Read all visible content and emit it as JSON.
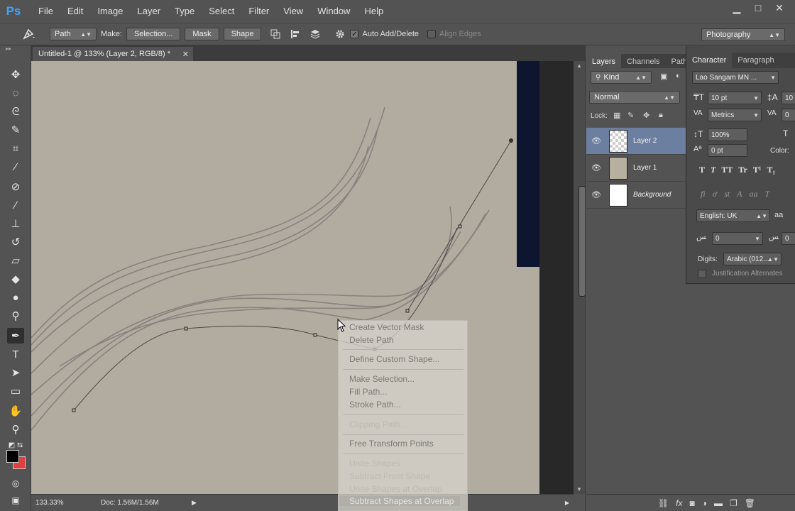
{
  "app": {
    "logo": "Ps"
  },
  "menu": [
    "File",
    "Edit",
    "Image",
    "Layer",
    "Type",
    "Select",
    "Filter",
    "View",
    "Window",
    "Help"
  ],
  "window_controls": {
    "minimize": "▁",
    "maximize": "□",
    "close": "✕"
  },
  "options_bar": {
    "mode": "Path",
    "make_label": "Make:",
    "selection_btn": "Selection...",
    "mask_btn": "Mask",
    "shape_btn": "Shape",
    "auto_add_delete": {
      "label": "Auto Add/Delete",
      "checked": true
    },
    "align_edges": {
      "label": "Align Edges",
      "checked": false
    },
    "workspace": "Photography"
  },
  "document": {
    "tab_title": "Untitled-1 @ 133% (Layer 2, RGB/8) *",
    "zoom": "133.33%",
    "doc_info": "Doc: 1.56M/1.56M"
  },
  "context_menu": {
    "items": [
      {
        "label": "Create Vector Mask",
        "enabled": true
      },
      {
        "label": "Delete Path",
        "enabled": true
      },
      {
        "label": "Define Custom Shape...",
        "enabled": true
      },
      {
        "label": "Make Selection...",
        "enabled": true
      },
      {
        "label": "Fill Path...",
        "enabled": true
      },
      {
        "label": "Stroke Path...",
        "enabled": true
      },
      {
        "label": "Clipping Path...",
        "enabled": false
      },
      {
        "label": "Free Transform Points",
        "enabled": true
      },
      {
        "label": "Unite Shapes",
        "enabled": false
      },
      {
        "label": "Subtract Front Shape",
        "enabled": false
      },
      {
        "label": "Unite Shapes at Overlap",
        "enabled": false
      },
      {
        "label": "Subtract Shapes at Overlap",
        "enabled": false
      }
    ]
  },
  "layers_panel": {
    "tabs": [
      "Layers",
      "Channels",
      "Paths"
    ],
    "filter_kind": "Kind",
    "blend_mode": "Normal",
    "lock_label": "Lock:",
    "layers": [
      {
        "name": "Layer 2",
        "selected": true
      },
      {
        "name": "Layer 1",
        "selected": false
      },
      {
        "name": "Background",
        "selected": false
      }
    ]
  },
  "character_panel": {
    "tabs": [
      "Character",
      "Paragraph"
    ],
    "font_family": "Lao Sangam MN ...",
    "font_size": "10 pt",
    "leading": "10",
    "kerning": "Metrics",
    "tracking": "0",
    "vertical_scale": "100%",
    "baseline_shift": "0 pt",
    "color_label": "Color:",
    "style_buttons": [
      "T",
      "T",
      "TT",
      "Tr",
      "T¹",
      "T₁"
    ],
    "opentype_buttons": [
      "fi",
      "ơ",
      "st",
      "A",
      "aa",
      "T"
    ],
    "language": "English: UK",
    "aa_label": "aa",
    "arabic_field": "0",
    "arabic_field_2": "0",
    "digits_label": "Digits:",
    "digits_value": "Arabic (012...",
    "justification_label": "Justification Alternates"
  },
  "colors": {
    "ui_bg": "#535353",
    "selected_layer": "#6c7fa0",
    "paper": "#b2aba0",
    "foreground": "#000000",
    "background": "#e04040"
  }
}
